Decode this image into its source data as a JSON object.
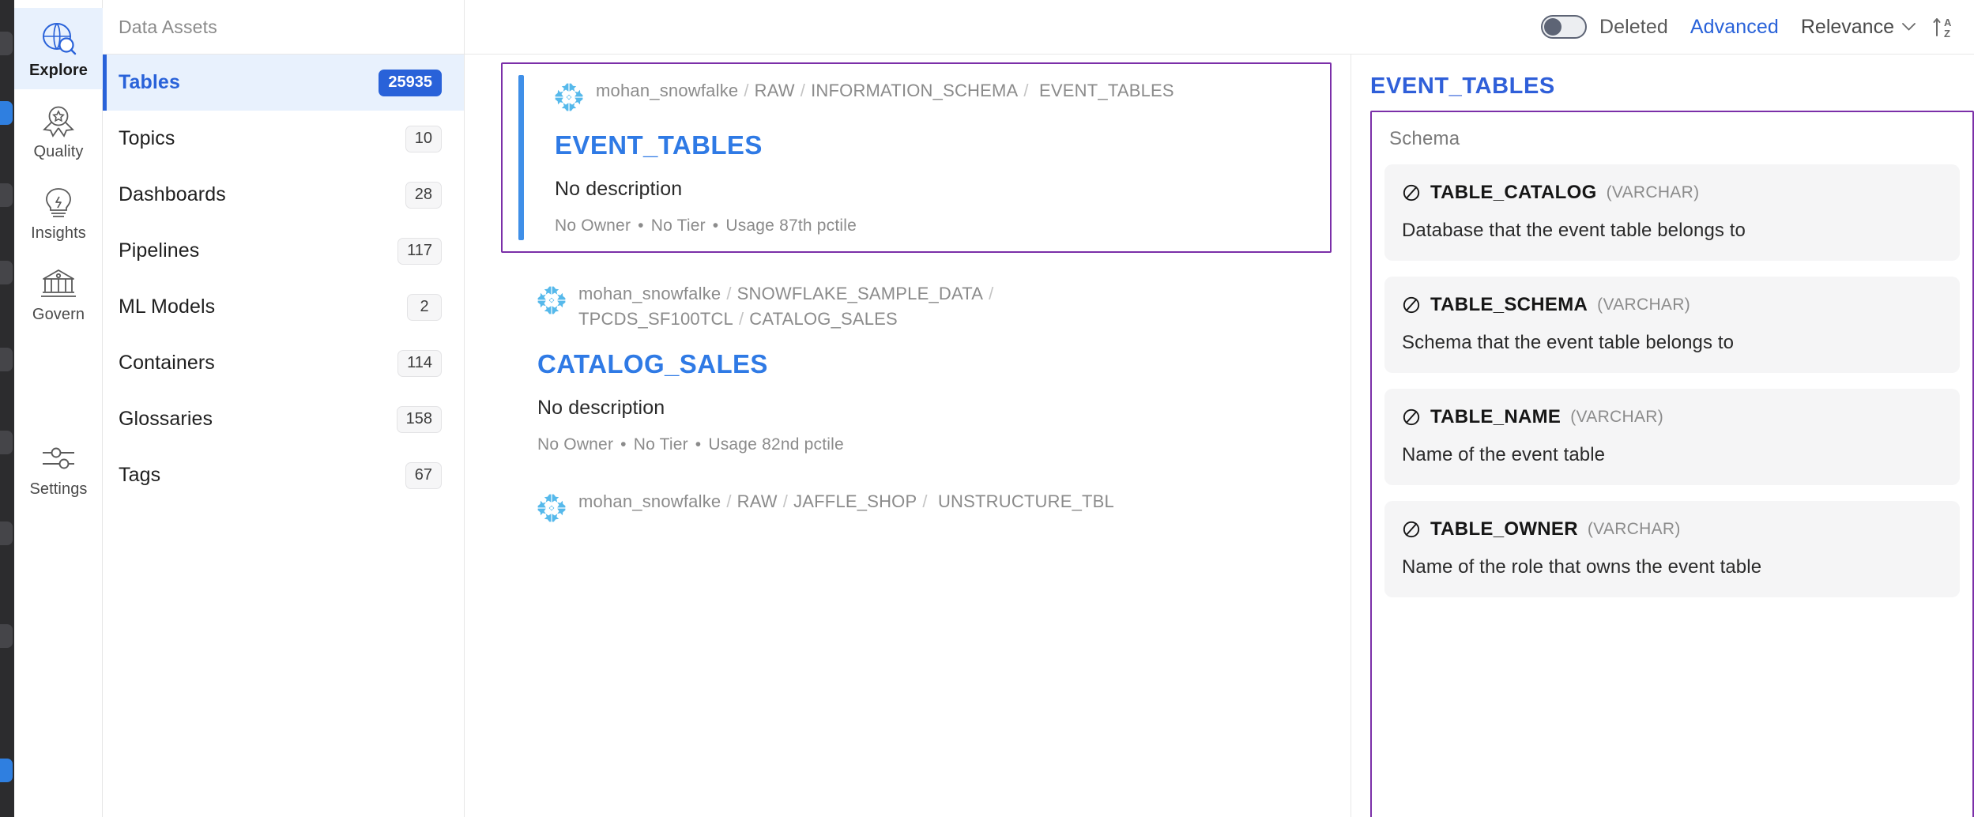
{
  "rail": {
    "items": [
      {
        "label": "Explore",
        "icon": "globe-search-icon",
        "active": true
      },
      {
        "label": "Quality",
        "icon": "quality-rosette-icon",
        "active": false
      },
      {
        "label": "Insights",
        "icon": "insights-bulb-icon",
        "active": false
      },
      {
        "label": "Govern",
        "icon": "govern-bank-icon",
        "active": false
      },
      {
        "label": "Settings",
        "icon": "settings-sliders-icon",
        "active": false
      }
    ]
  },
  "sidebar": {
    "title": "Data Assets",
    "items": [
      {
        "label": "Tables",
        "count": "25935",
        "active": true
      },
      {
        "label": "Topics",
        "count": "10",
        "active": false
      },
      {
        "label": "Dashboards",
        "count": "28",
        "active": false
      },
      {
        "label": "Pipelines",
        "count": "117",
        "active": false
      },
      {
        "label": "ML Models",
        "count": "2",
        "active": false
      },
      {
        "label": "Containers",
        "count": "114",
        "active": false
      },
      {
        "label": "Glossaries",
        "count": "158",
        "active": false
      },
      {
        "label": "Tags",
        "count": "67",
        "active": false
      }
    ]
  },
  "topbar": {
    "deleted_label": "Deleted",
    "deleted_toggle_state": "off",
    "advanced_label": "Advanced",
    "sort_label": "Relevance",
    "sort_chevron_icon": "chevron-down-icon",
    "sort_direction_icon": "sort-a-z-ascending-icon"
  },
  "results": [
    {
      "platform_icon": "snowflake-icon",
      "breadcrumb": [
        "mohan_snowfalke",
        "RAW",
        "INFORMATION_SCHEMA",
        "EVENT_TABLES"
      ],
      "title": "EVENT_TABLES",
      "description": "No description",
      "meta": [
        "No Owner",
        "No Tier",
        "Usage 87th pctile"
      ],
      "selected": true
    },
    {
      "platform_icon": "snowflake-icon",
      "breadcrumb": [
        "mohan_snowfalke",
        "SNOWFLAKE_SAMPLE_DATA",
        "TPCDS_SF100TCL",
        "CATALOG_SALES"
      ],
      "title": "CATALOG_SALES",
      "description": "No description",
      "meta": [
        "No Owner",
        "No Tier",
        "Usage 82nd pctile"
      ],
      "selected": false
    },
    {
      "platform_icon": "snowflake-icon",
      "breadcrumb": [
        "mohan_snowfalke",
        "RAW",
        "JAFFLE_SHOP",
        "UNSTRUCTURE_TBL"
      ],
      "title": "",
      "description": "",
      "meta": [],
      "selected": false
    }
  ],
  "detail": {
    "title": "EVENT_TABLES",
    "section_label": "Schema",
    "fields": [
      {
        "type_icon": "string-type-icon",
        "name": "TABLE_CATALOG",
        "type": "(VARCHAR)",
        "description": "Database that the event table belongs to"
      },
      {
        "type_icon": "string-type-icon",
        "name": "TABLE_SCHEMA",
        "type": "(VARCHAR)",
        "description": "Schema that the event table belongs to"
      },
      {
        "type_icon": "string-type-icon",
        "name": "TABLE_NAME",
        "type": "(VARCHAR)",
        "description": "Name of the event table"
      },
      {
        "type_icon": "string-type-icon",
        "name": "TABLE_OWNER",
        "type": "(VARCHAR)",
        "description": "Name of the role that owns the event table"
      }
    ]
  },
  "colors": {
    "accent_blue": "#2962d9",
    "link_blue": "#2f7ae5",
    "highlight_purple": "#7b2fa8",
    "snowflake_blue": "#56b9eb",
    "selected_bg": "#e8f1fd"
  }
}
